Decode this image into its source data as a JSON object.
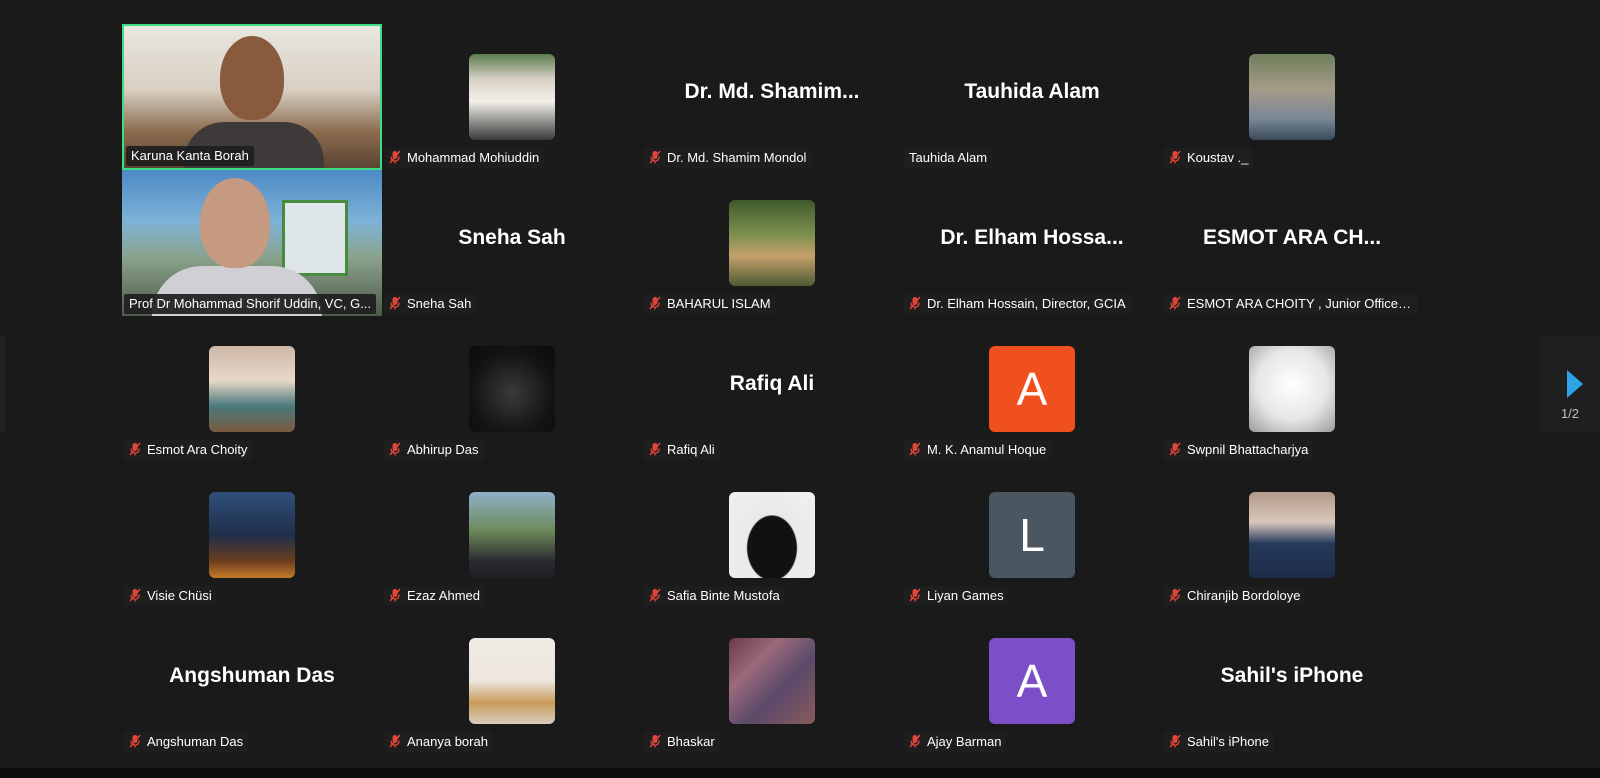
{
  "pager": "1/2",
  "colors": {
    "background": "#1a1a1a",
    "active_speaker_border": "#3ddc84",
    "mute_red": "#e0453a",
    "nav_arrow": "#2ea3e8"
  },
  "participants": [
    {
      "name": "Karuna Kanta Borah",
      "kind": "video",
      "active": true,
      "muted": false
    },
    {
      "name": "Mohammad Mohiuddin",
      "kind": "photo",
      "photo_desc": "man-in-white-cap",
      "muted": true
    },
    {
      "name": "Dr. Md. Shamim Mondol",
      "display": "Dr. Md. Shamim...",
      "kind": "text",
      "muted": true
    },
    {
      "name": "Tauhida Alam",
      "display": "Tauhida Alam",
      "kind": "text",
      "muted": false
    },
    {
      "name": "Koustav ._",
      "kind": "photo",
      "photo_desc": "person-by-mountain",
      "muted": true
    },
    {
      "name": "Prof Dr Mohammad Shorif Uddin, VC, G...",
      "kind": "video",
      "active": false,
      "muted": false
    },
    {
      "name": "Sneha Sah",
      "display": "Sneha Sah",
      "kind": "text",
      "muted": true
    },
    {
      "name": "BAHARUL ISLAM",
      "kind": "photo",
      "photo_desc": "man-in-forest",
      "muted": true
    },
    {
      "name": "Dr. Elham Hossain, Director, GCIA",
      "display": "Dr. Elham Hossa...",
      "kind": "text",
      "muted": true
    },
    {
      "name": "ESMOT ARA CHOITY ,  Junior Officer, ...",
      "display": "ESMOT ARA CH...",
      "kind": "text",
      "muted": true
    },
    {
      "name": "Esmot Ara Choity",
      "kind": "photo",
      "photo_desc": "woman-portrait",
      "muted": true
    },
    {
      "name": "Abhirup Das",
      "kind": "photo",
      "photo_desc": "dark-batman",
      "muted": true
    },
    {
      "name": "Rafiq Ali",
      "display": "Rafiq Ali",
      "kind": "text",
      "muted": true
    },
    {
      "name": "M. K. Anamul Hoque",
      "kind": "initial",
      "initial": "A",
      "color": "#f0501e",
      "muted": true
    },
    {
      "name": "Swpnil Bhattacharjya",
      "kind": "photo",
      "photo_desc": "skull-sketch",
      "muted": true
    },
    {
      "name": "Visie Chüsi",
      "kind": "photo",
      "photo_desc": "night-city",
      "muted": true
    },
    {
      "name": "Ezaz Ahmed",
      "kind": "photo",
      "photo_desc": "man-outdoors",
      "muted": true
    },
    {
      "name": "Safia Binte Mustofa",
      "kind": "photo",
      "photo_desc": "niqab",
      "muted": true
    },
    {
      "name": "Liyan Games",
      "kind": "initial",
      "initial": "L",
      "color": "#4a5760",
      "muted": true
    },
    {
      "name": "Chiranjib Bordoloye",
      "kind": "photo",
      "photo_desc": "man-in-suit",
      "muted": true
    },
    {
      "name": "Angshuman Das",
      "display": "Angshuman Das",
      "kind": "text",
      "muted": true
    },
    {
      "name": "Ananya borah",
      "kind": "photo",
      "photo_desc": "child",
      "muted": true
    },
    {
      "name": "Bhaskar",
      "kind": "photo",
      "photo_desc": "painting",
      "muted": true
    },
    {
      "name": "Ajay Barman",
      "kind": "initial",
      "initial": "A",
      "color": "#7c4fc8",
      "muted": true
    },
    {
      "name": "Sahil's iPhone",
      "display": "Sahil's iPhone",
      "kind": "text",
      "muted": true
    }
  ]
}
